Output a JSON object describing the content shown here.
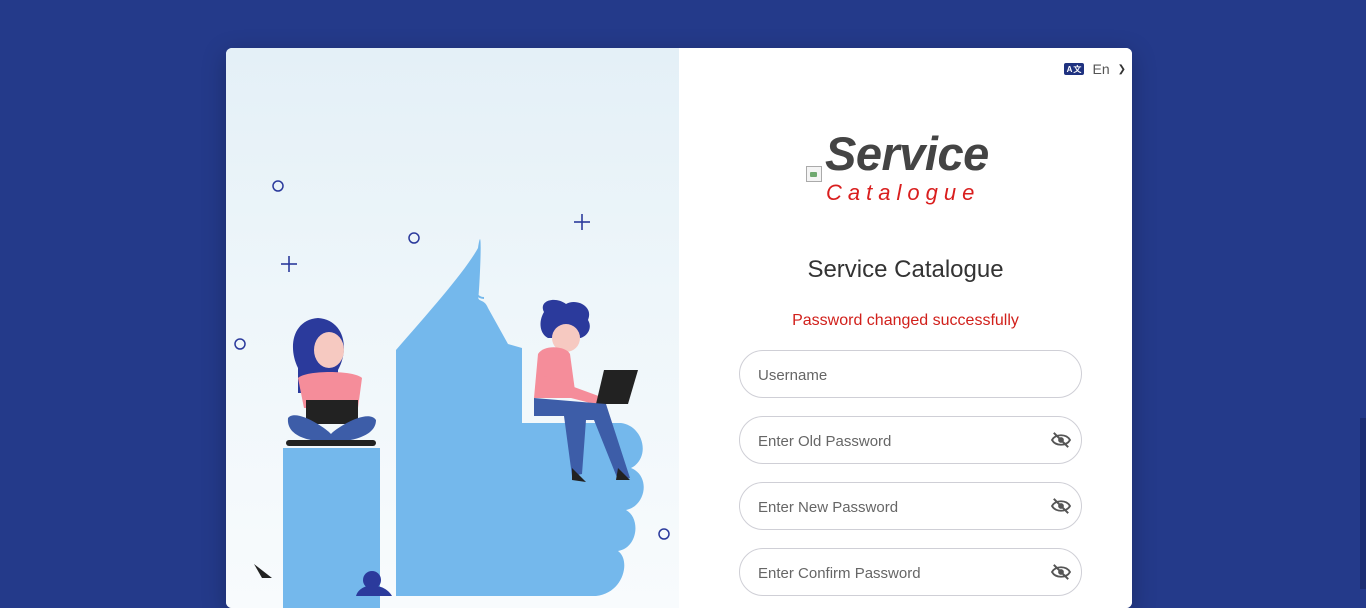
{
  "language": {
    "icon": "translate-icon",
    "icon_text": "A文",
    "selected": "En",
    "dropdown_icon": "chevron-down-icon"
  },
  "logo": {
    "main_text": "Service",
    "sub_text": "Catalogue",
    "main_color": "#444444",
    "sub_color": "#d91e1e"
  },
  "title": "Service Catalogue",
  "message": "Password changed successfully",
  "form": {
    "username": {
      "placeholder": "Username",
      "value": ""
    },
    "old_password": {
      "placeholder": "Enter Old Password",
      "value": "",
      "icon": "eye-slash-icon"
    },
    "new_password": {
      "placeholder": "Enter New Password",
      "value": "",
      "icon": "eye-slash-icon"
    },
    "confirm_password": {
      "placeholder": "Enter Confirm Password",
      "value": "",
      "icon": "eye-slash-icon"
    }
  },
  "colors": {
    "background": "#243a8a",
    "accent": "#1f3280",
    "error": "#d1201b",
    "illustration_blue": "#74b8ec"
  }
}
